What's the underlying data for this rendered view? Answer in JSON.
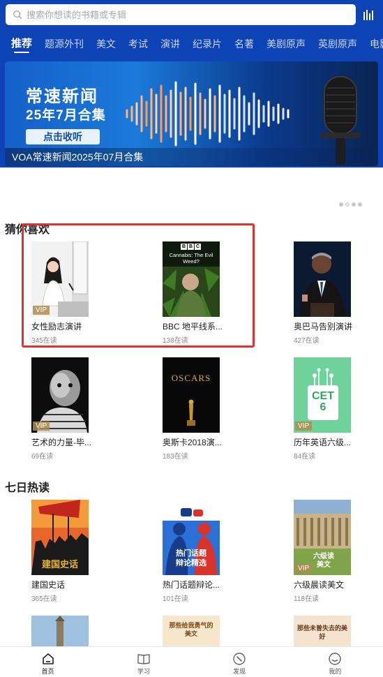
{
  "search": {
    "placeholder": "搜索你想读的书籍或专辑"
  },
  "tabs": [
    {
      "label": "推荐",
      "active": true
    },
    {
      "label": "题源外刊"
    },
    {
      "label": "美文"
    },
    {
      "label": "考试"
    },
    {
      "label": "演讲"
    },
    {
      "label": "纪录片"
    },
    {
      "label": "名著"
    },
    {
      "label": "美剧原声"
    },
    {
      "label": "英剧原声"
    },
    {
      "label": "电影原"
    }
  ],
  "banner": {
    "title": "常速新闻",
    "subtitle": "25年7月合集",
    "button": "点击收听",
    "caption": "VOA常速新闻2025年07月合集"
  },
  "sections": {
    "guess": {
      "title": "猜你喜欢",
      "items": [
        {
          "title": "女性励志演讲",
          "count": "345在读",
          "vip": "VIP"
        },
        {
          "title": "BBC 地平线系...",
          "count": "138在读",
          "cover_text": "Cannabis: The Evil Weed?",
          "cover_brand": "BBC"
        },
        {
          "title": "奥巴马告别演讲",
          "count": "427在读"
        },
        {
          "title": "艺术的力量-毕...",
          "count": "69在读",
          "vip": "VIP"
        },
        {
          "title": "奥斯卡2018演...",
          "count": "183在读",
          "cover_text": "OSCARS"
        },
        {
          "title": "历年英语六级...",
          "count": "84在读",
          "vip": "VIP",
          "cover_text": "CET 6"
        }
      ]
    },
    "hot": {
      "title": "七日热读",
      "items": [
        {
          "title": "建国史话",
          "count": "365在读",
          "cover_text": "建国史话"
        },
        {
          "title": "热门话题辩论...",
          "count": "101在读",
          "cover_text": "热门话题辩论精选"
        },
        {
          "title": "六级晨读美文",
          "count": "118在读",
          "vip": "VIP",
          "cover_text": "六级读美文"
        }
      ],
      "partial": [
        {
          "cover_text": ""
        },
        {
          "cover_text": "那些给我勇气的美文"
        },
        {
          "cover_text": "那些未曾失去的美好"
        }
      ]
    }
  },
  "nav": [
    {
      "label": "首页",
      "icon": "home-icon",
      "active": true
    },
    {
      "label": "学习",
      "icon": "book-icon"
    },
    {
      "label": "发现",
      "icon": "compass-icon"
    },
    {
      "label": "我的",
      "icon": "profile-icon"
    }
  ],
  "colors": {
    "header": "#0d43b5",
    "highlight": "#e03030",
    "vip": "#af8c50"
  }
}
